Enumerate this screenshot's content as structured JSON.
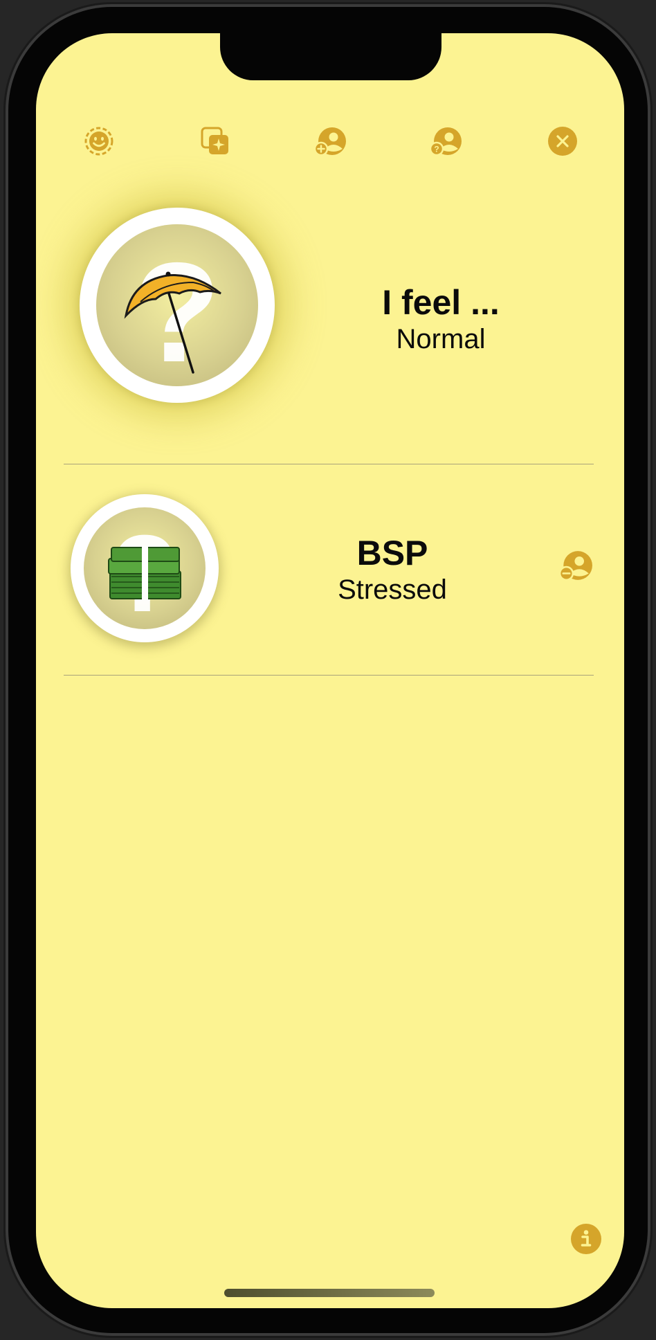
{
  "colors": {
    "background": "#fcf392",
    "accent": "#d5a52a",
    "text": "#0b0b0b",
    "divider": "#a9a37a"
  },
  "toolbar": {
    "icons": [
      "smiley-dashed-icon",
      "sparkle-photo-icon",
      "add-person-icon",
      "person-question-icon",
      "close-icon"
    ]
  },
  "self_entry": {
    "title": "I feel ...",
    "mood": "Normal",
    "image_icon": "umbrella-question-icon"
  },
  "contacts": [
    {
      "name": "BSP",
      "mood": "Stressed",
      "image_icon": "money-stack-question-icon",
      "action_icon": "remove-person-icon"
    }
  ],
  "footer": {
    "info_icon": "info-icon"
  }
}
